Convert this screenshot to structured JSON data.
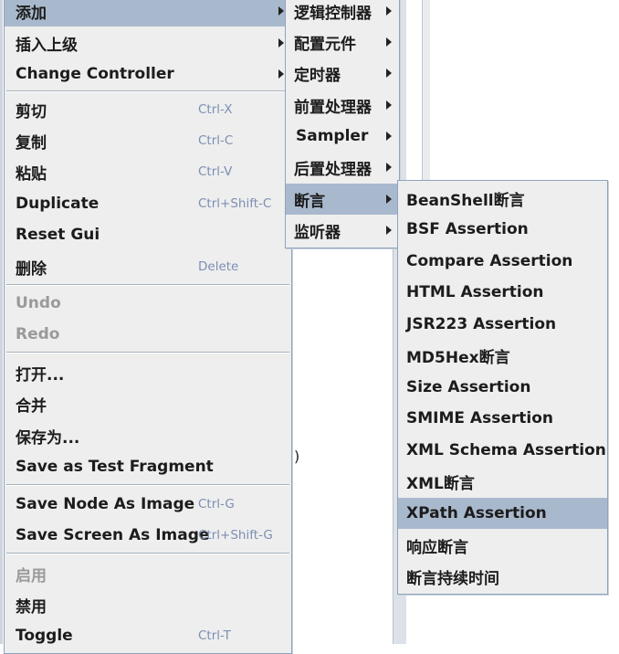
{
  "main_menu": {
    "items": [
      {
        "label": "添加",
        "has_submenu": true,
        "selected": true
      },
      {
        "label": "插入上级",
        "has_submenu": true
      },
      {
        "label": "Change Controller",
        "has_submenu": true
      },
      {
        "label": "剪切",
        "shortcut": "Ctrl-X"
      },
      {
        "label": "复制",
        "shortcut": "Ctrl-C"
      },
      {
        "label": "粘贴",
        "shortcut": "Ctrl-V"
      },
      {
        "label": "Duplicate",
        "shortcut": "Ctrl+Shift-C"
      },
      {
        "label": "Reset Gui"
      },
      {
        "label": "删除",
        "shortcut": "Delete"
      },
      {
        "label": "Undo",
        "disabled": true
      },
      {
        "label": "Redo",
        "disabled": true
      },
      {
        "label": "打开..."
      },
      {
        "label": "合并"
      },
      {
        "label": "保存为..."
      },
      {
        "label": "Save as Test Fragment"
      },
      {
        "label": "Save Node As Image",
        "shortcut": "Ctrl-G"
      },
      {
        "label": "Save Screen As Image",
        "shortcut": "Ctrl+Shift-G"
      },
      {
        "label": "启用",
        "disabled": true
      },
      {
        "label": "禁用"
      },
      {
        "label": "Toggle",
        "shortcut": "Ctrl-T"
      }
    ]
  },
  "add_submenu": {
    "items": [
      {
        "label": "逻辑控制器"
      },
      {
        "label": "配置元件"
      },
      {
        "label": "定时器"
      },
      {
        "label": "前置处理器"
      },
      {
        "label": "Sampler"
      },
      {
        "label": "后置处理器"
      },
      {
        "label": "断言",
        "selected": true
      },
      {
        "label": "监听器"
      }
    ]
  },
  "assertion_submenu": {
    "items": [
      {
        "label": "BeanShell断言"
      },
      {
        "label": "BSF Assertion"
      },
      {
        "label": "Compare Assertion"
      },
      {
        "label": "HTML Assertion"
      },
      {
        "label": "JSR223 Assertion"
      },
      {
        "label": "MD5Hex断言"
      },
      {
        "label": "Size Assertion"
      },
      {
        "label": "SMIME Assertion"
      },
      {
        "label": "XML Schema Assertion"
      },
      {
        "label": "XML断言"
      },
      {
        "label": "XPath Assertion",
        "selected": true
      },
      {
        "label": "响应断言"
      },
      {
        "label": "断言持续时间"
      }
    ]
  },
  "background": {
    "stray_text": ")"
  },
  "colors": {
    "menu_bg": "#eeeeee",
    "selection": "#a9b9cd",
    "shortcut": "#7c8fb2",
    "disabled": "#9a9a9a",
    "border": "#8ea4bf"
  }
}
